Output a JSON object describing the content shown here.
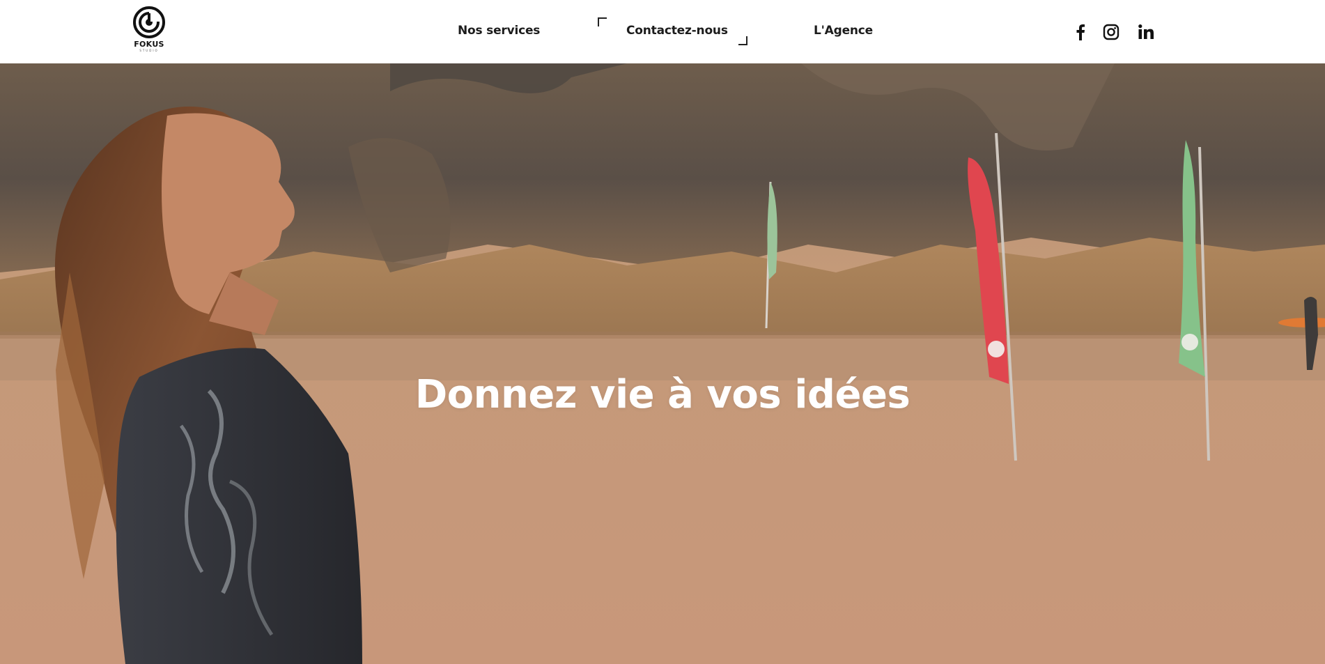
{
  "brand": {
    "name": "FOKUS",
    "tagline": "STUDIO"
  },
  "nav": {
    "items": [
      {
        "label": "Nos services"
      },
      {
        "label": "Contactez-nous"
      },
      {
        "label": "L'Agence"
      }
    ]
  },
  "social": {
    "icons": [
      "facebook-icon",
      "instagram-icon",
      "linkedin-icon"
    ]
  },
  "hero": {
    "title": "Donnez vie à vos idées"
  },
  "colors": {
    "header_bg": "#ffffff",
    "text_dark": "#1c1c1c",
    "hero_text": "#ffffff"
  }
}
